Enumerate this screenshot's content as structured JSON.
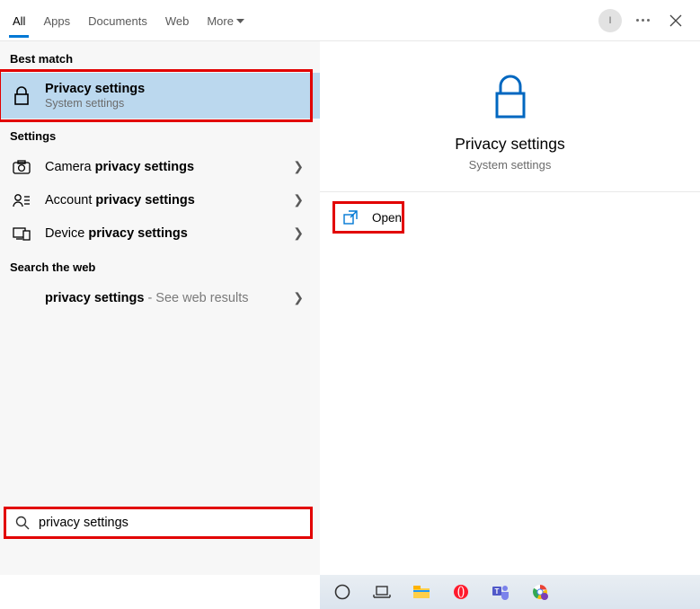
{
  "tabs": {
    "all": "All",
    "apps": "Apps",
    "documents": "Documents",
    "web": "Web",
    "more": "More"
  },
  "avatar_letter": "I",
  "sections": {
    "best_match": "Best match",
    "settings": "Settings",
    "search_web": "Search the web"
  },
  "best": {
    "title": "Privacy settings",
    "sub": "System settings"
  },
  "settings_items": [
    {
      "prefix": "Camera ",
      "bold": "privacy settings"
    },
    {
      "prefix": "Account ",
      "bold": "privacy settings"
    },
    {
      "prefix": "Device ",
      "bold": "privacy settings"
    }
  ],
  "web_item": {
    "bold": "privacy settings",
    "suffix": " - See web results"
  },
  "preview": {
    "title": "Privacy settings",
    "sub": "System settings"
  },
  "action_open": "Open",
  "search_value": "privacy settings"
}
